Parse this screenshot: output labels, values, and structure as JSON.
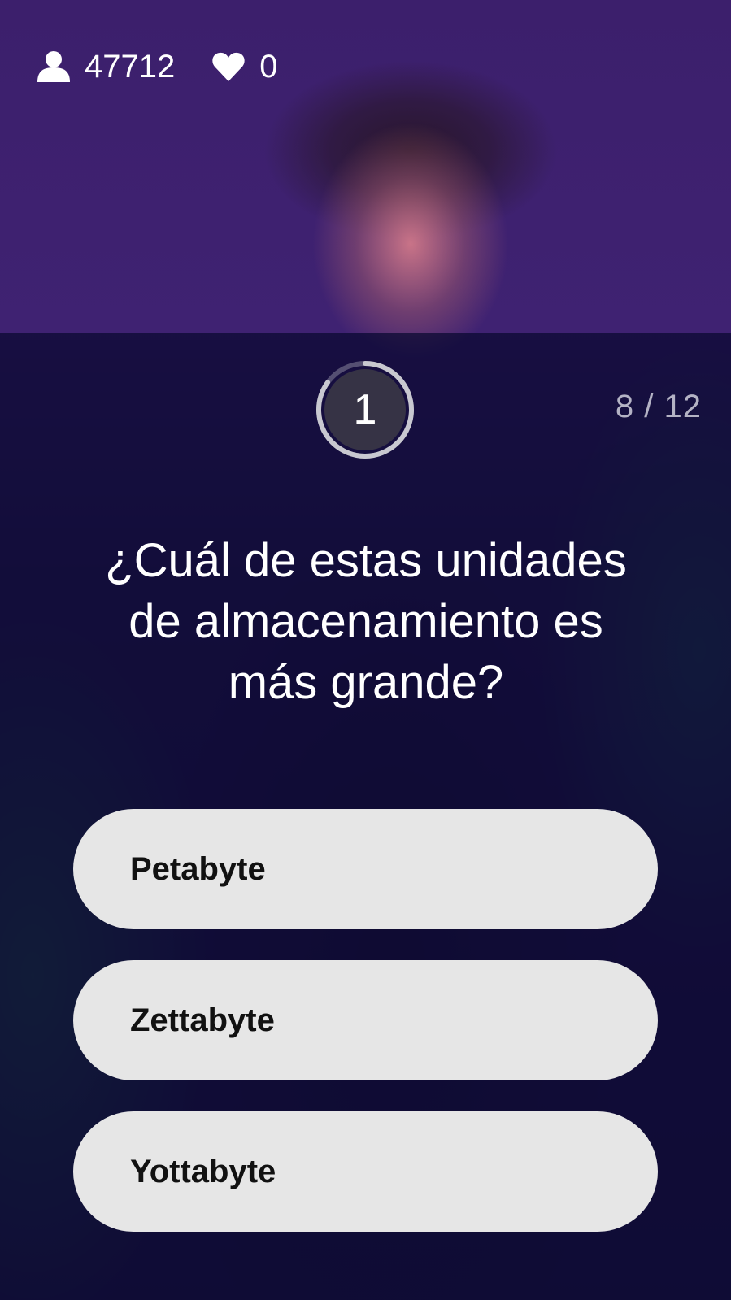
{
  "header": {
    "viewers": "47712",
    "lives": "0",
    "viewers_icon": "user-icon",
    "lives_icon": "heart-icon"
  },
  "quiz": {
    "timer": "1",
    "timer_level": 0.85,
    "progress": "8 / 12",
    "question": "¿Cuál de estas unidades de almacenamiento es más grande?",
    "answers": [
      {
        "label": "Petabyte"
      },
      {
        "label": "Zettabyte"
      },
      {
        "label": "Yottabyte"
      }
    ]
  },
  "colors": {
    "overlay": "#0e0a34",
    "answer_bg": "#e6e6e6",
    "answer_text": "#111111",
    "timer_ring": "#c8c8d0"
  }
}
